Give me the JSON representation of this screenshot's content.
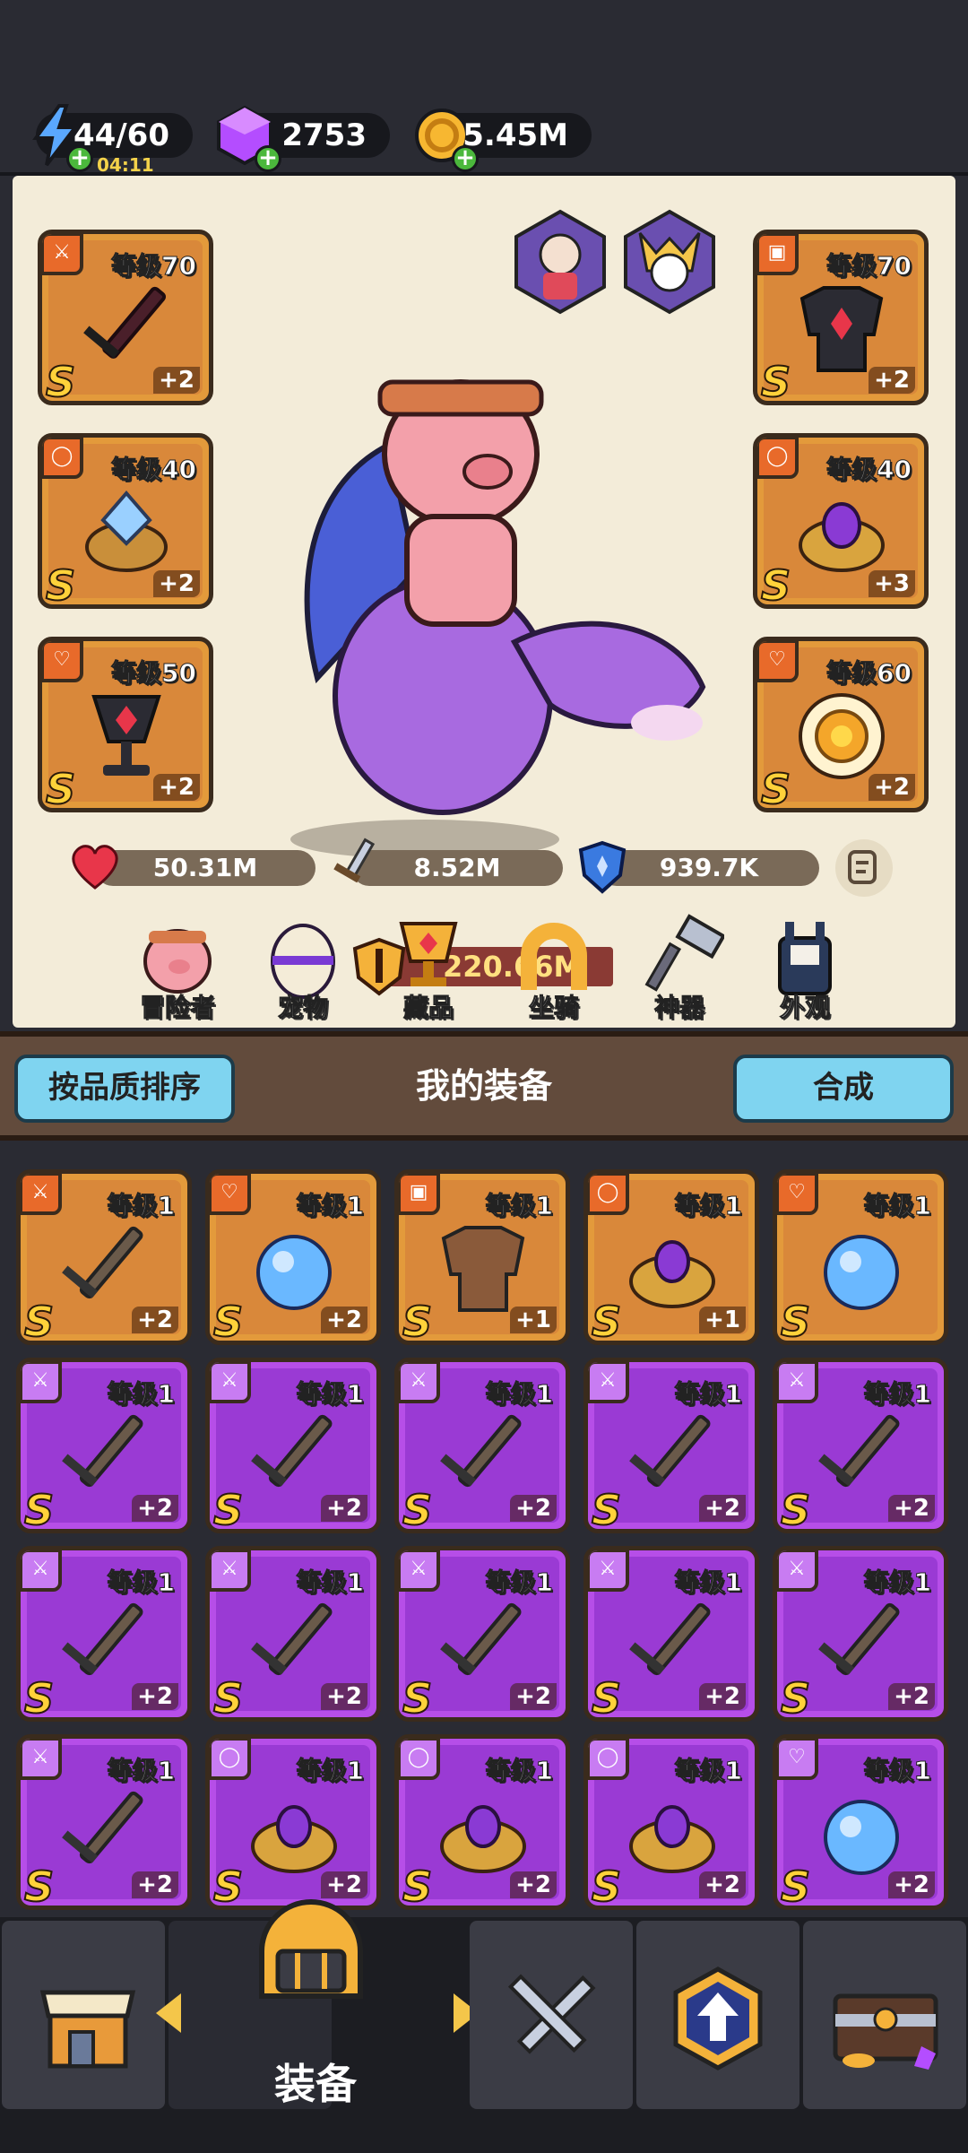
{
  "resources": {
    "energy": {
      "value": "44/60",
      "timer": "04:11",
      "icon": "lightning-icon"
    },
    "gems": {
      "value": "2753",
      "icon": "purple-gem-icon"
    },
    "gold": {
      "value": "5.45M",
      "icon": "gold-coin-icon"
    }
  },
  "hero": {
    "left_slots": [
      {
        "level": "等级70",
        "bonus": "+2",
        "grade": "S",
        "type": "sword"
      },
      {
        "level": "等级40",
        "bonus": "+2",
        "grade": "S",
        "type": "ring"
      },
      {
        "level": "等级50",
        "bonus": "+2",
        "grade": "S",
        "type": "necklace"
      }
    ],
    "right_slots": [
      {
        "level": "等级70",
        "bonus": "+2",
        "grade": "S",
        "type": "armor"
      },
      {
        "level": "等级40",
        "bonus": "+3",
        "grade": "S",
        "type": "ring"
      },
      {
        "level": "等级60",
        "bonus": "+2",
        "grade": "S",
        "type": "necklace"
      }
    ],
    "power": "220.66M",
    "stats": {
      "hp": "50.31M",
      "attack": "8.52M",
      "defense": "939.7K"
    }
  },
  "categories": [
    "冒险者",
    "宠物",
    "藏品",
    "坐骑",
    "神器",
    "外观"
  ],
  "equipment_header": {
    "sort_label": "按品质排序",
    "title": "我的装备",
    "merge_label": "合成"
  },
  "inventory": [
    {
      "level": "等级1",
      "bonus": "+2",
      "rarity": "orange",
      "type": "sword"
    },
    {
      "level": "等级1",
      "bonus": "+2",
      "rarity": "orange",
      "type": "necklace"
    },
    {
      "level": "等级1",
      "bonus": "+1",
      "rarity": "orange",
      "type": "armor"
    },
    {
      "level": "等级1",
      "bonus": "+1",
      "rarity": "orange",
      "type": "ring"
    },
    {
      "level": "等级1",
      "bonus": "",
      "rarity": "orange",
      "type": "necklace"
    },
    {
      "level": "等级1",
      "bonus": "+2",
      "rarity": "purple",
      "type": "sword"
    },
    {
      "level": "等级1",
      "bonus": "+2",
      "rarity": "purple",
      "type": "sword"
    },
    {
      "level": "等级1",
      "bonus": "+2",
      "rarity": "purple",
      "type": "sword"
    },
    {
      "level": "等级1",
      "bonus": "+2",
      "rarity": "purple",
      "type": "sword"
    },
    {
      "level": "等级1",
      "bonus": "+2",
      "rarity": "purple",
      "type": "sword"
    },
    {
      "level": "等级1",
      "bonus": "+2",
      "rarity": "purple",
      "type": "sword"
    },
    {
      "level": "等级1",
      "bonus": "+2",
      "rarity": "purple",
      "type": "sword"
    },
    {
      "level": "等级1",
      "bonus": "+2",
      "rarity": "purple",
      "type": "sword"
    },
    {
      "level": "等级1",
      "bonus": "+2",
      "rarity": "purple",
      "type": "sword"
    },
    {
      "level": "等级1",
      "bonus": "+2",
      "rarity": "purple",
      "type": "sword"
    },
    {
      "level": "等级1",
      "bonus": "+2",
      "rarity": "purple",
      "type": "sword"
    },
    {
      "level": "等级1",
      "bonus": "+2",
      "rarity": "purple",
      "type": "ring"
    },
    {
      "level": "等级1",
      "bonus": "+2",
      "rarity": "purple",
      "type": "ring"
    },
    {
      "level": "等级1",
      "bonus": "+2",
      "rarity": "purple",
      "type": "ring"
    },
    {
      "level": "等级1",
      "bonus": "+2",
      "rarity": "purple",
      "type": "necklace"
    }
  ],
  "bottom_nav": {
    "active_label": "装备"
  },
  "colors": {
    "orange_tile": "#e39a3b",
    "purple_tile": "#b64ee8",
    "blue_button": "#7fd4f0",
    "panel": "#f3ecd9"
  }
}
